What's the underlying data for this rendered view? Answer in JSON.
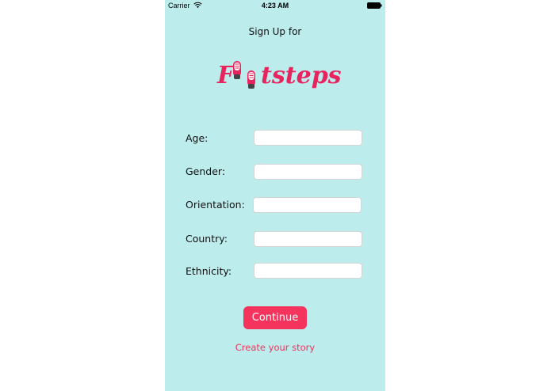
{
  "status_bar": {
    "carrier": "Carrier",
    "time": "4:23 AM",
    "wifi_icon": "wifi-icon",
    "battery_icon": "battery-icon"
  },
  "header": {
    "title": "Sign Up for"
  },
  "logo": {
    "text": "Footsteps",
    "letter_f": "F",
    "rest": "tsteps",
    "icon": "sneaker-icon",
    "color": "#e8245e"
  },
  "form": {
    "fields": [
      {
        "label": "Age:",
        "value": "",
        "placeholder": ""
      },
      {
        "label": "Gender:",
        "value": "",
        "placeholder": ""
      },
      {
        "label": "Orientation:",
        "value": "",
        "placeholder": ""
      },
      {
        "label": "Country:",
        "value": "",
        "placeholder": ""
      },
      {
        "label": "Ethnicity:",
        "value": "",
        "placeholder": ""
      }
    ]
  },
  "actions": {
    "continue_label": "Continue",
    "create_story_label": "Create your story"
  },
  "colors": {
    "background": "#bdeced",
    "accent": "#f4345c"
  }
}
